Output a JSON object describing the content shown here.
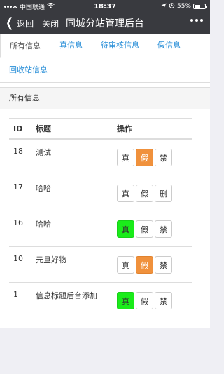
{
  "status_bar": {
    "carrier": "中国联通",
    "time": "18:37",
    "battery_text": "55%",
    "battery_level": 0.55
  },
  "nav": {
    "back_label": "返回",
    "close_label": "关闭",
    "title": "同城分站管理后台"
  },
  "tabs": [
    {
      "label": "所有信息",
      "active": true
    },
    {
      "label": "真信息",
      "active": false
    },
    {
      "label": "待审核信息",
      "active": false
    },
    {
      "label": "假信息",
      "active": false
    },
    {
      "label": "回收站信息",
      "active": false
    }
  ],
  "panel": {
    "heading": "所有信息"
  },
  "table": {
    "headers": [
      "ID",
      "标题",
      "操作"
    ],
    "rows": [
      {
        "id": "18",
        "title": "测试",
        "buttons": [
          {
            "label": "真",
            "state": "normal"
          },
          {
            "label": "假",
            "state": "orange"
          },
          {
            "label": "禁",
            "state": "normal"
          }
        ]
      },
      {
        "id": "17",
        "title": "哈哈",
        "buttons": [
          {
            "label": "真",
            "state": "normal"
          },
          {
            "label": "假",
            "state": "normal"
          },
          {
            "label": "删",
            "state": "normal"
          }
        ]
      },
      {
        "id": "16",
        "title": "哈哈",
        "buttons": [
          {
            "label": "真",
            "state": "green"
          },
          {
            "label": "假",
            "state": "normal"
          },
          {
            "label": "禁",
            "state": "normal"
          }
        ]
      },
      {
        "id": "10",
        "title": "元旦好物",
        "buttons": [
          {
            "label": "真",
            "state": "normal"
          },
          {
            "label": "假",
            "state": "orange"
          },
          {
            "label": "禁",
            "state": "normal"
          }
        ]
      },
      {
        "id": "1",
        "title": "信息标题后台添加",
        "buttons": [
          {
            "label": "真",
            "state": "green"
          },
          {
            "label": "假",
            "state": "normal"
          },
          {
            "label": "禁",
            "state": "normal"
          }
        ]
      }
    ]
  },
  "colors": {
    "nav_bg": "#393a3f",
    "tab_link": "#2a8fd8",
    "btn_green": "#1aec1a",
    "btn_orange": "#f0913c"
  }
}
